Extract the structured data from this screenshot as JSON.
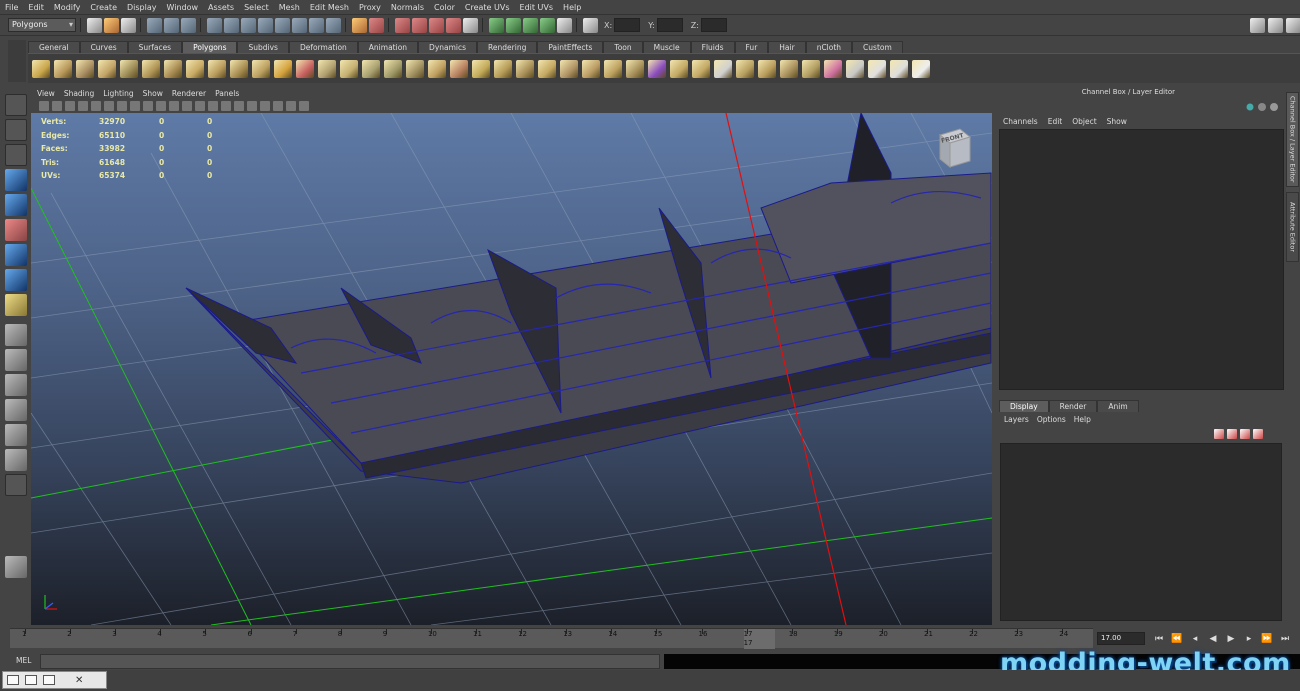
{
  "menubar": {
    "items": [
      "File",
      "Edit",
      "Modify",
      "Create",
      "Display",
      "Window",
      "Assets",
      "Select",
      "Mesh",
      "Edit Mesh",
      "Proxy",
      "Normals",
      "Color",
      "Create UVs",
      "Edit UVs",
      "Help"
    ]
  },
  "statusline": {
    "mode": "Polygons",
    "x_label": "X:",
    "y_label": "Y:",
    "z_label": "Z:"
  },
  "shelf": {
    "tabs": [
      "General",
      "Curves",
      "Surfaces",
      "Polygons",
      "Subdivs",
      "Deformation",
      "Animation",
      "Dynamics",
      "Rendering",
      "PaintEffects",
      "Toon",
      "Muscle",
      "Fluids",
      "Fur",
      "Hair",
      "nCloth",
      "Custom"
    ],
    "active": "Polygons"
  },
  "viewport": {
    "menu": [
      "View",
      "Shading",
      "Lighting",
      "Show",
      "Renderer",
      "Panels"
    ],
    "hud": [
      {
        "label": "Verts:",
        "value": "32970",
        "c2": "0",
        "c3": "0"
      },
      {
        "label": "Edges:",
        "value": "65110",
        "c2": "0",
        "c3": "0"
      },
      {
        "label": "Faces:",
        "value": "33982",
        "c2": "0",
        "c3": "0"
      },
      {
        "label": "Tris:",
        "value": "61648",
        "c2": "0",
        "c3": "0"
      },
      {
        "label": "UVs:",
        "value": "65374",
        "c2": "0",
        "c3": "0"
      }
    ],
    "viewcube_label": "FRONT"
  },
  "channelbox": {
    "title": "Channel Box / Layer Editor",
    "menu": [
      "Channels",
      "Edit",
      "Object",
      "Show"
    ],
    "side_tabs": [
      "Channel Box / Layer Editor",
      "Attribute Editor"
    ]
  },
  "layereditor": {
    "tabs": [
      "Display",
      "Render",
      "Anim"
    ],
    "active": "Display",
    "menu": [
      "Layers",
      "Options",
      "Help"
    ]
  },
  "timeline": {
    "labels": [
      "1",
      "2",
      "3",
      "4",
      "5",
      "6",
      "7",
      "8",
      "9",
      "10",
      "11",
      "12",
      "13",
      "14",
      "15",
      "16",
      "17",
      "18",
      "19",
      "20",
      "21",
      "22",
      "23",
      "24"
    ],
    "current_frame": "17",
    "current_time": "17.00"
  },
  "commandline": {
    "label": "MEL"
  },
  "watermark": "modding-welt.com",
  "colors": {
    "viewport_top": "#5e7aa6",
    "viewport_bottom": "#1c2029",
    "wire": "#1a1a8c",
    "hud_text": "#e9e9a6",
    "axis_red": "#e01010",
    "axis_green": "#20c020"
  }
}
